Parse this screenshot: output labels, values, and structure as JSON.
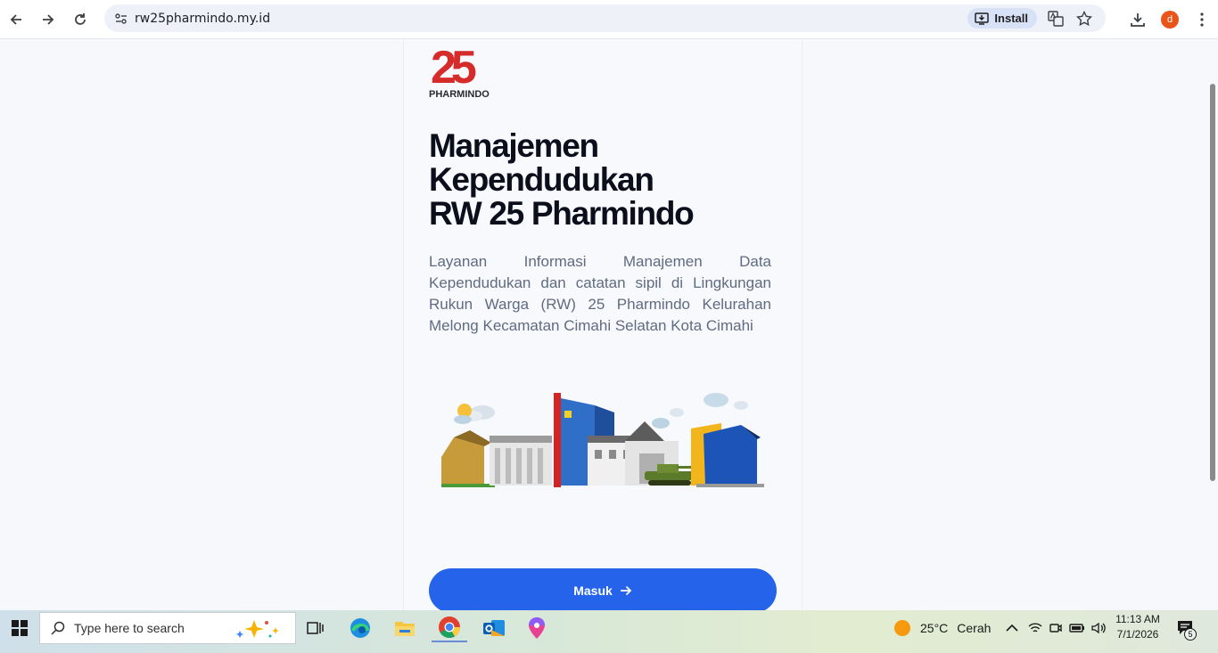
{
  "browser": {
    "url": "rw25pharmindo.my.id",
    "install_label": "Install",
    "profile_initial": "d"
  },
  "page": {
    "logo_number": "25",
    "logo_text": "PHARMINDO",
    "title_lines": [
      "Manajemen",
      "Kependudukan",
      "RW 25 Pharmindo"
    ],
    "description": "Layanan Informasi Manajemen Data Kependudukan dan catatan sipil di Lingkungan Rukun Warga (RW) 25 Pharmindo Kelurahan Melong Kecamatan Cimahi Selatan Kota Cimahi",
    "cta_label": "Masuk"
  },
  "taskbar": {
    "search_placeholder": "Type here to search",
    "weather_temp": "25°C",
    "weather_desc": "Cerah",
    "time": "11:13 AM",
    "date": "7/1/2026",
    "notification_count": "5"
  },
  "colors": {
    "accent": "#2563eb",
    "logo_red": "#d62b2b",
    "profile": "#e8541a"
  }
}
